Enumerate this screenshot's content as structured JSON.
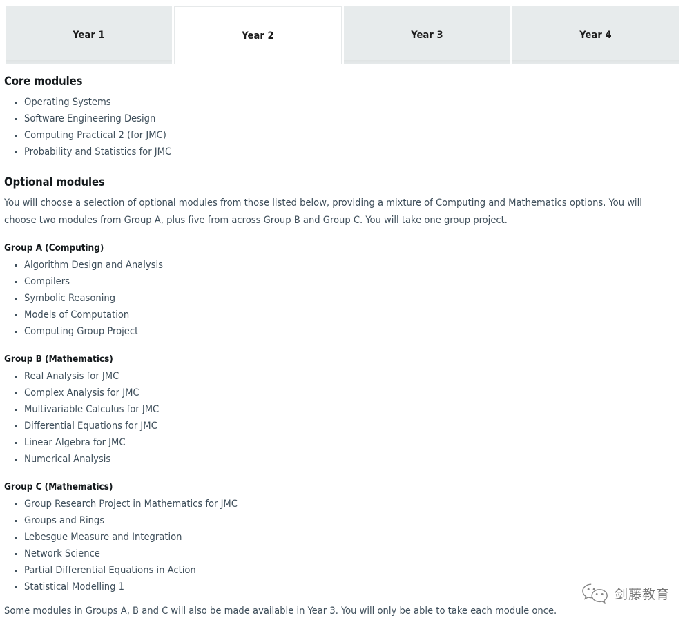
{
  "tabs": [
    {
      "label": "Year 1",
      "active": false
    },
    {
      "label": "Year 2",
      "active": true
    },
    {
      "label": "Year 3",
      "active": false
    },
    {
      "label": "Year 4",
      "active": false
    }
  ],
  "core": {
    "heading": "Core modules",
    "modules": [
      "Operating Systems",
      "Software Engineering Design",
      "Computing Practical 2 (for JMC)",
      "Probability and Statistics for JMC"
    ]
  },
  "optional": {
    "heading": "Optional modules",
    "intro": "You will choose a selection of optional modules from those listed below, providing a mixture of Computing and Mathematics options. You will choose two modules from Group A, plus five from across Group B and Group C. You will take one group project.",
    "groups": [
      {
        "heading": "Group A (Computing)",
        "modules": [
          "Algorithm Design and Analysis",
          "Compilers",
          "Symbolic Reasoning",
          "Models of Computation",
          "Computing Group Project"
        ]
      },
      {
        "heading": "Group B (Mathematics)",
        "modules": [
          "Real Analysis for JMC",
          "Complex Analysis for JMC",
          "Multivariable Calculus for JMC",
          "Differential Equations for JMC",
          "Linear Algebra for JMC",
          "Numerical Analysis"
        ]
      },
      {
        "heading": "Group C (Mathematics)",
        "modules": [
          "Group Research Project in Mathematics for JMC",
          "Groups and Rings",
          "Lebesgue Measure and Integration",
          "Network Science",
          "Partial Differential Equations in Action",
          "Statistical Modelling 1"
        ]
      }
    ]
  },
  "footer_note": "Some modules in Groups A, B and C will also be made available in Year 3. You will only be able to take each module once.",
  "watermark": {
    "icon": "wechat-icon",
    "text": "剑藤教育"
  },
  "colors": {
    "tab_inactive_bg": "#e7ebec",
    "tab_active_bg": "#ffffff",
    "heading_text": "#14191c",
    "body_text": "#3f4f5b",
    "page_bg": "#ffffff"
  }
}
